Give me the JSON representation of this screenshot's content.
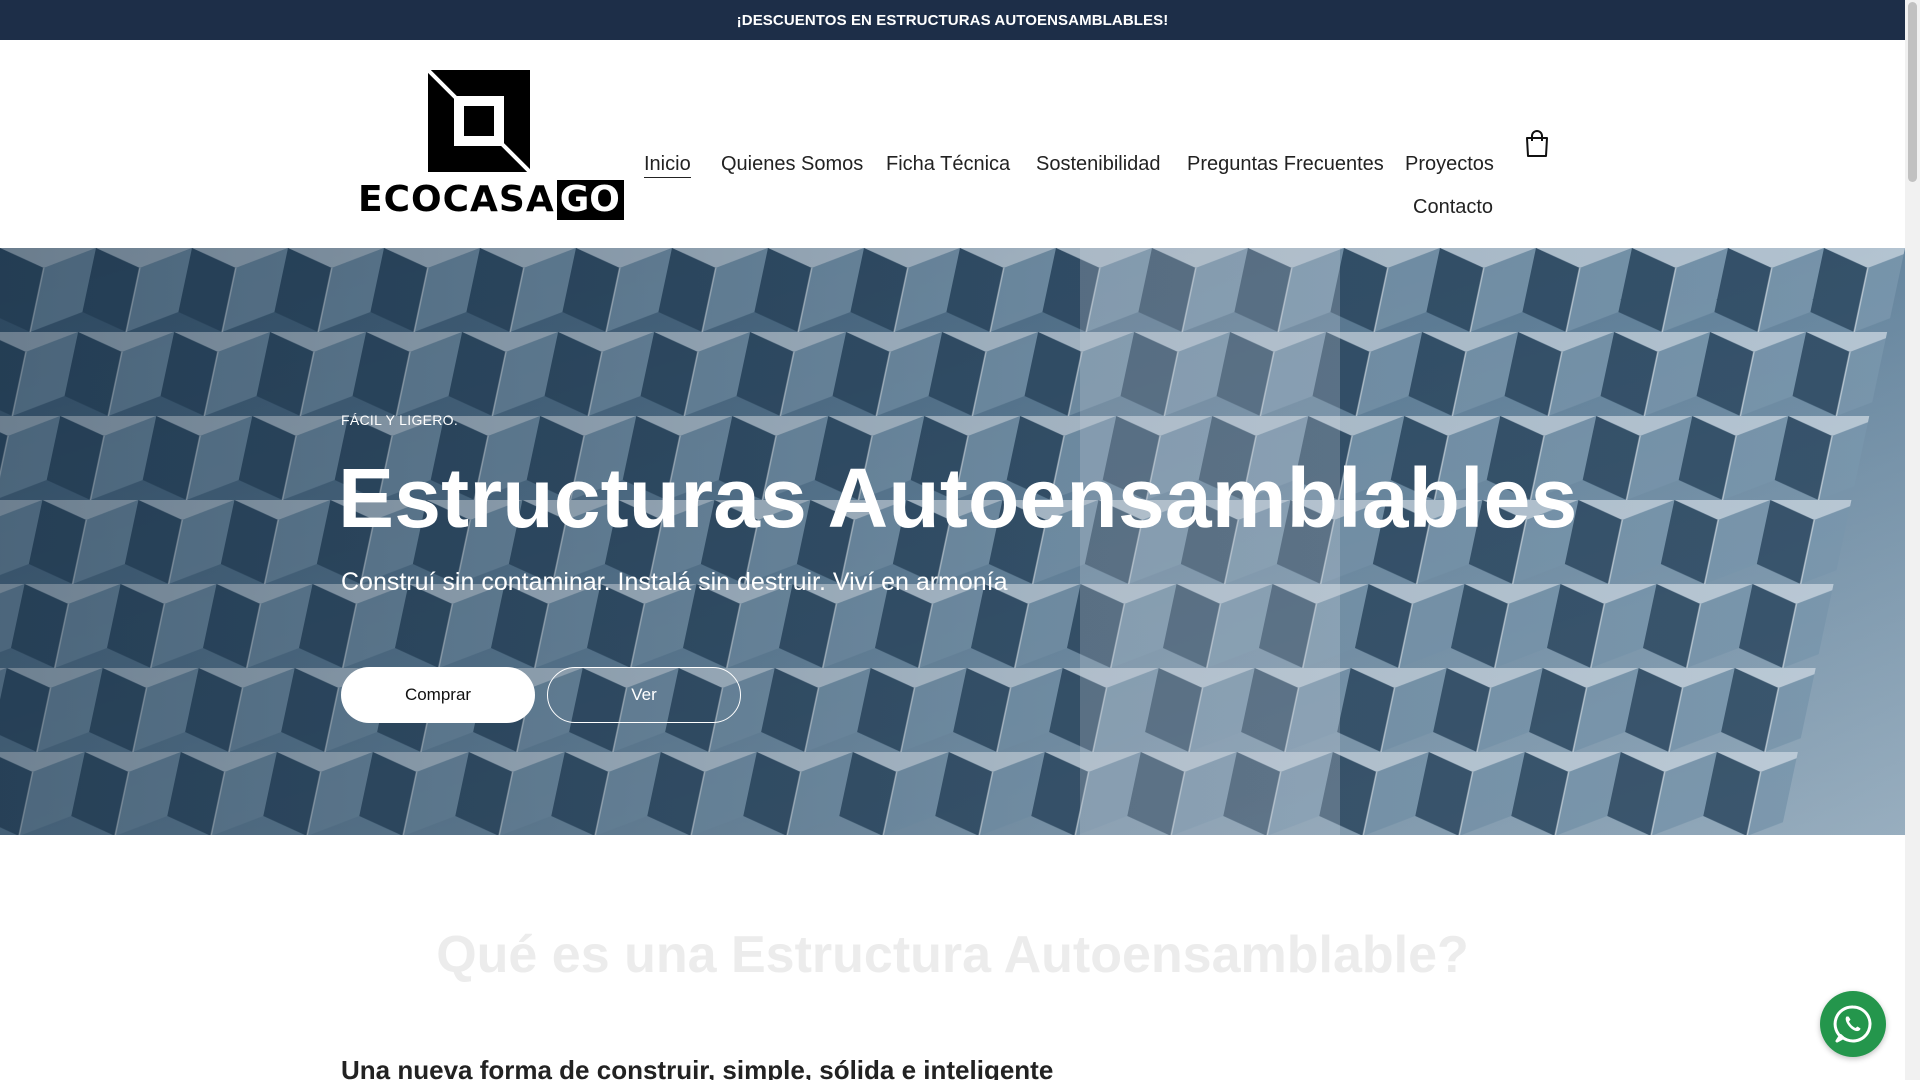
{
  "announcement": {
    "text": "¡DESCUENTOS EN ESTRUCTURAS AUTOENSAMBLABLES!"
  },
  "logo": {
    "word": "ECOCASA",
    "word_highlight": "GO"
  },
  "nav": {
    "items": [
      {
        "label": "Inicio",
        "active": true
      },
      {
        "label": "Quienes Somos"
      },
      {
        "label": "Ficha Técnica"
      },
      {
        "label": "Sostenibilidad"
      },
      {
        "label": "Preguntas Frecuentes"
      },
      {
        "label": "Proyectos"
      },
      {
        "label": "Contacto"
      }
    ],
    "cart_icon": "shopping-bag-icon"
  },
  "hero": {
    "eyebrow": "FÁCIL Y LIGERO.",
    "title": "Estructuras Autoensamblables",
    "subtitle": "Construí sin contaminar. Instalá sin destruir. Viví en armonía",
    "primary_button": "Comprar",
    "secondary_button": "Ver"
  },
  "section": {
    "title": "Qué es una Estructura Autoensamblable?",
    "subtitle": "Una nueva forma de construir, simple, sólida e inteligente"
  },
  "floating": {
    "whatsapp_icon": "whatsapp-icon"
  },
  "colors": {
    "announcement_bg": "#1d2e48",
    "whatsapp": "#24964c"
  }
}
